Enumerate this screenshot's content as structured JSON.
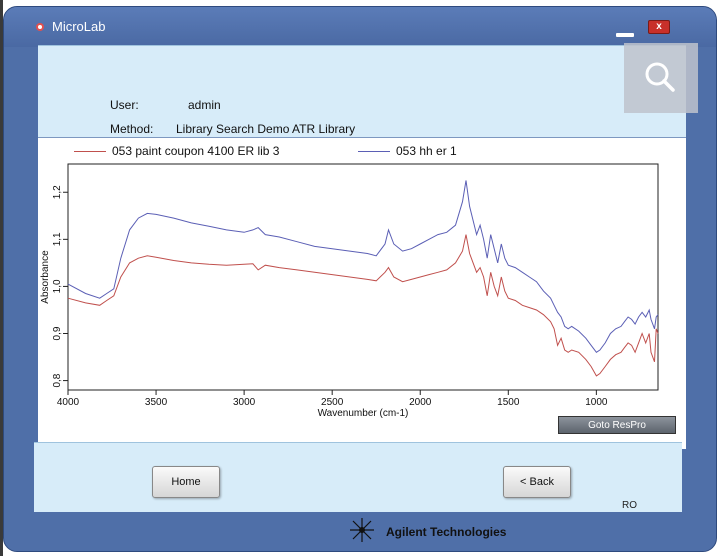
{
  "window": {
    "title": "MicroLab",
    "close_glyph": "x"
  },
  "header": {
    "user_label": "User:",
    "user_value": "admin",
    "method_label": "Method:",
    "method_value": "Library Search Demo ATR Library"
  },
  "icons": {
    "search": "search-icon",
    "app": "microlab-icon",
    "brand": "agilent-spark-icon"
  },
  "chart_data": {
    "type": "line",
    "xlabel": "Wavenumber (cm-1)",
    "ylabel": "Absorbance",
    "xlim": [
      4000,
      650
    ],
    "ylim": [
      0.78,
      1.26
    ],
    "x_reversed": true,
    "x_ticks": [
      4000,
      3500,
      3000,
      2500,
      2000,
      1500,
      1000
    ],
    "y_ticks": [
      0.8,
      0.9,
      1.0,
      1.1,
      1.2
    ],
    "y_tick_labels": [
      "0,8",
      "0,9",
      "1,0",
      "1,1",
      "1,2"
    ],
    "legend_position": "top",
    "grid": false,
    "series": [
      {
        "name": "053 paint coupon 4100 ER lib 3",
        "color": "#c0504d",
        "points": [
          [
            4000,
            0.975
          ],
          [
            3900,
            0.965
          ],
          [
            3820,
            0.96
          ],
          [
            3780,
            0.97
          ],
          [
            3740,
            0.98
          ],
          [
            3700,
            1.02
          ],
          [
            3650,
            1.05
          ],
          [
            3600,
            1.06
          ],
          [
            3550,
            1.065
          ],
          [
            3500,
            1.062
          ],
          [
            3400,
            1.055
          ],
          [
            3300,
            1.05
          ],
          [
            3200,
            1.047
          ],
          [
            3100,
            1.045
          ],
          [
            3000,
            1.047
          ],
          [
            2950,
            1.048
          ],
          [
            2920,
            1.035
          ],
          [
            2880,
            1.045
          ],
          [
            2800,
            1.04
          ],
          [
            2700,
            1.035
          ],
          [
            2600,
            1.03
          ],
          [
            2500,
            1.025
          ],
          [
            2400,
            1.02
          ],
          [
            2300,
            1.015
          ],
          [
            2250,
            1.012
          ],
          [
            2200,
            1.03
          ],
          [
            2180,
            1.04
          ],
          [
            2150,
            1.02
          ],
          [
            2100,
            1.01
          ],
          [
            2050,
            1.015
          ],
          [
            2000,
            1.02
          ],
          [
            1950,
            1.025
          ],
          [
            1900,
            1.03
          ],
          [
            1850,
            1.035
          ],
          [
            1800,
            1.05
          ],
          [
            1760,
            1.075
          ],
          [
            1740,
            1.11
          ],
          [
            1720,
            1.07
          ],
          [
            1700,
            1.05
          ],
          [
            1680,
            1.03
          ],
          [
            1660,
            1.04
          ],
          [
            1640,
            1.02
          ],
          [
            1620,
            0.98
          ],
          [
            1600,
            1.03
          ],
          [
            1580,
            1.0
          ],
          [
            1560,
            0.98
          ],
          [
            1540,
            1.02
          ],
          [
            1520,
            0.99
          ],
          [
            1500,
            0.975
          ],
          [
            1460,
            0.97
          ],
          [
            1420,
            0.96
          ],
          [
            1380,
            0.955
          ],
          [
            1340,
            0.95
          ],
          [
            1300,
            0.94
          ],
          [
            1260,
            0.925
          ],
          [
            1240,
            0.91
          ],
          [
            1220,
            0.875
          ],
          [
            1200,
            0.89
          ],
          [
            1180,
            0.865
          ],
          [
            1160,
            0.86
          ],
          [
            1140,
            0.865
          ],
          [
            1100,
            0.86
          ],
          [
            1060,
            0.845
          ],
          [
            1030,
            0.83
          ],
          [
            1000,
            0.81
          ],
          [
            980,
            0.815
          ],
          [
            950,
            0.83
          ],
          [
            920,
            0.845
          ],
          [
            890,
            0.855
          ],
          [
            860,
            0.86
          ],
          [
            840,
            0.87
          ],
          [
            820,
            0.88
          ],
          [
            800,
            0.875
          ],
          [
            780,
            0.86
          ],
          [
            760,
            0.88
          ],
          [
            740,
            0.9
          ],
          [
            720,
            0.88
          ],
          [
            700,
            0.9
          ],
          [
            690,
            0.86
          ],
          [
            670,
            0.84
          ],
          [
            660,
            0.91
          ],
          [
            650,
            0.9
          ]
        ]
      },
      {
        "name": "053 hh er 1",
        "color": "#5b5fb5",
        "points": [
          [
            4000,
            1.005
          ],
          [
            3900,
            0.985
          ],
          [
            3820,
            0.975
          ],
          [
            3780,
            0.985
          ],
          [
            3740,
            0.995
          ],
          [
            3700,
            1.06
          ],
          [
            3650,
            1.12
          ],
          [
            3600,
            1.145
          ],
          [
            3550,
            1.155
          ],
          [
            3500,
            1.153
          ],
          [
            3400,
            1.145
          ],
          [
            3300,
            1.135
          ],
          [
            3200,
            1.128
          ],
          [
            3100,
            1.12
          ],
          [
            3000,
            1.115
          ],
          [
            2950,
            1.12
          ],
          [
            2920,
            1.125
          ],
          [
            2880,
            1.11
          ],
          [
            2800,
            1.105
          ],
          [
            2700,
            1.095
          ],
          [
            2600,
            1.085
          ],
          [
            2500,
            1.08
          ],
          [
            2400,
            1.075
          ],
          [
            2300,
            1.07
          ],
          [
            2250,
            1.065
          ],
          [
            2200,
            1.09
          ],
          [
            2180,
            1.12
          ],
          [
            2150,
            1.09
          ],
          [
            2100,
            1.075
          ],
          [
            2050,
            1.08
          ],
          [
            2000,
            1.09
          ],
          [
            1950,
            1.1
          ],
          [
            1900,
            1.11
          ],
          [
            1850,
            1.115
          ],
          [
            1800,
            1.13
          ],
          [
            1760,
            1.18
          ],
          [
            1740,
            1.225
          ],
          [
            1720,
            1.17
          ],
          [
            1700,
            1.14
          ],
          [
            1680,
            1.11
          ],
          [
            1660,
            1.13
          ],
          [
            1640,
            1.1
          ],
          [
            1620,
            1.06
          ],
          [
            1600,
            1.11
          ],
          [
            1580,
            1.08
          ],
          [
            1560,
            1.05
          ],
          [
            1540,
            1.09
          ],
          [
            1520,
            1.06
          ],
          [
            1500,
            1.045
          ],
          [
            1460,
            1.04
          ],
          [
            1420,
            1.03
          ],
          [
            1380,
            1.02
          ],
          [
            1340,
            1.01
          ],
          [
            1300,
            0.99
          ],
          [
            1260,
            0.975
          ],
          [
            1240,
            0.96
          ],
          [
            1220,
            0.945
          ],
          [
            1200,
            0.935
          ],
          [
            1180,
            0.915
          ],
          [
            1160,
            0.91
          ],
          [
            1140,
            0.915
          ],
          [
            1100,
            0.905
          ],
          [
            1060,
            0.89
          ],
          [
            1030,
            0.875
          ],
          [
            1000,
            0.86
          ],
          [
            980,
            0.865
          ],
          [
            950,
            0.88
          ],
          [
            920,
            0.9
          ],
          [
            890,
            0.91
          ],
          [
            860,
            0.915
          ],
          [
            840,
            0.925
          ],
          [
            820,
            0.935
          ],
          [
            800,
            0.93
          ],
          [
            780,
            0.92
          ],
          [
            760,
            0.935
          ],
          [
            740,
            0.945
          ],
          [
            720,
            0.935
          ],
          [
            700,
            0.95
          ],
          [
            690,
            0.93
          ],
          [
            670,
            0.91
          ],
          [
            660,
            0.935
          ],
          [
            650,
            0.94
          ]
        ]
      }
    ]
  },
  "buttons": {
    "goto_respro": "Goto ResPro",
    "home": "Home",
    "back": "< Back"
  },
  "footer": {
    "ro": "RO",
    "brand": "Agilent Technologies"
  }
}
